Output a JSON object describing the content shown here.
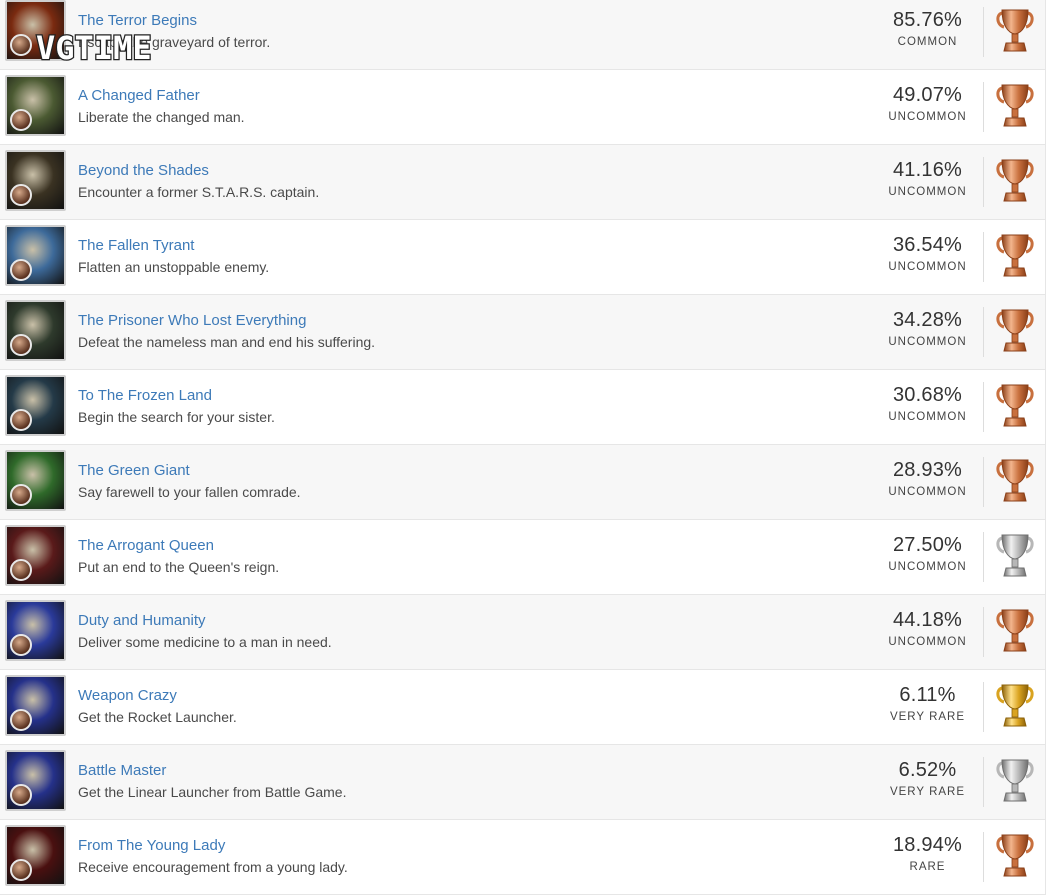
{
  "trophies": [
    {
      "name": "The Terror Begins",
      "description": "Escape the graveyard of terror.",
      "percent": "85.76%",
      "rarity": "COMMON",
      "tier": "bronze",
      "art": "#7a2a10"
    },
    {
      "name": "A Changed Father",
      "description": "Liberate the changed man.",
      "percent": "49.07%",
      "rarity": "UNCOMMON",
      "tier": "bronze",
      "art": "#4b5a32"
    },
    {
      "name": "Beyond the Shades",
      "description": "Encounter a former S.T.A.R.S. captain.",
      "percent": "41.16%",
      "rarity": "UNCOMMON",
      "tier": "bronze",
      "art": "#3a3222"
    },
    {
      "name": "The Fallen Tyrant",
      "description": "Flatten an unstoppable enemy.",
      "percent": "36.54%",
      "rarity": "UNCOMMON",
      "tier": "bronze",
      "art": "#3d6a9a"
    },
    {
      "name": "The Prisoner Who Lost Everything",
      "description": "Defeat the nameless man and end his suffering.",
      "percent": "34.28%",
      "rarity": "UNCOMMON",
      "tier": "bronze",
      "art": "#2e3a2c"
    },
    {
      "name": "To The Frozen Land",
      "description": "Begin the search for your sister.",
      "percent": "30.68%",
      "rarity": "UNCOMMON",
      "tier": "bronze",
      "art": "#243a48"
    },
    {
      "name": "The Green Giant",
      "description": "Say farewell to your fallen comrade.",
      "percent": "28.93%",
      "rarity": "UNCOMMON",
      "tier": "bronze",
      "art": "#2f6a2a"
    },
    {
      "name": "The Arrogant Queen",
      "description": "Put an end to the Queen's reign.",
      "percent": "27.50%",
      "rarity": "UNCOMMON",
      "tier": "silver",
      "art": "#5a1a1a"
    },
    {
      "name": "Duty and Humanity",
      "description": "Deliver some medicine to a man in need.",
      "percent": "44.18%",
      "rarity": "UNCOMMON",
      "tier": "bronze",
      "art": "#2a3a9a"
    },
    {
      "name": "Weapon Crazy",
      "description": "Get the Rocket Launcher.",
      "percent": "6.11%",
      "rarity": "VERY RARE",
      "tier": "gold",
      "art": "#25318a"
    },
    {
      "name": "Battle Master",
      "description": "Get the Linear Launcher from Battle Game.",
      "percent": "6.52%",
      "rarity": "VERY RARE",
      "tier": "silver",
      "art": "#25318a"
    },
    {
      "name": "From The Young Lady",
      "description": "Receive encouragement from a young lady.",
      "percent": "18.94%",
      "rarity": "RARE",
      "tier": "bronze",
      "art": "#4a1010"
    }
  ],
  "watermark": "VGTIME",
  "tier_colors": {
    "bronze": {
      "light": "#f3b58d",
      "mid": "#c8703e",
      "dark": "#8a3f18"
    },
    "silver": {
      "light": "#f1f1f1",
      "mid": "#b7b7b7",
      "dark": "#6f6f6f"
    },
    "gold": {
      "light": "#ffe18a",
      "mid": "#d9a320",
      "dark": "#8c6108"
    }
  }
}
